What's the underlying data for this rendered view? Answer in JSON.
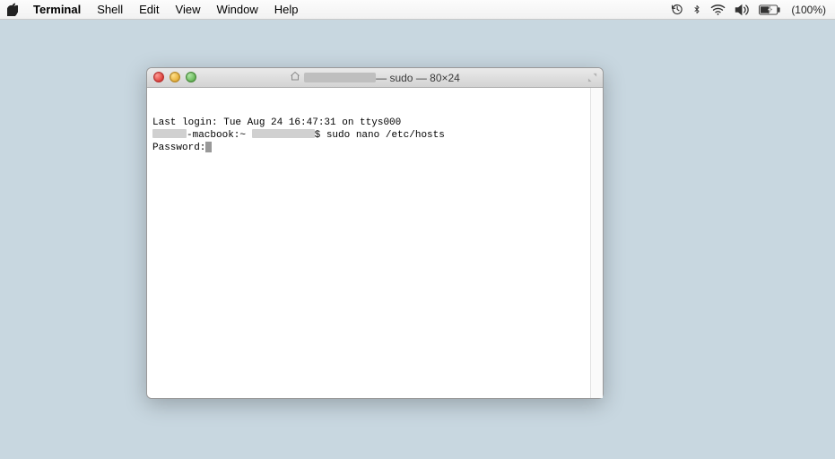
{
  "menubar": {
    "app_name": "Terminal",
    "items": [
      "Shell",
      "Edit",
      "View",
      "Window",
      "Help"
    ],
    "right": {
      "battery_text": "(100%)"
    }
  },
  "window": {
    "title_suffix": " — sudo — 80×24"
  },
  "terminal": {
    "last_login_line": "Last login: Tue Aug 24 16:47:31 on ttys000",
    "prompt_mid": "-macbook:~ ",
    "prompt_end": "$ sudo nano /etc/hosts",
    "password_label": "Password:"
  }
}
